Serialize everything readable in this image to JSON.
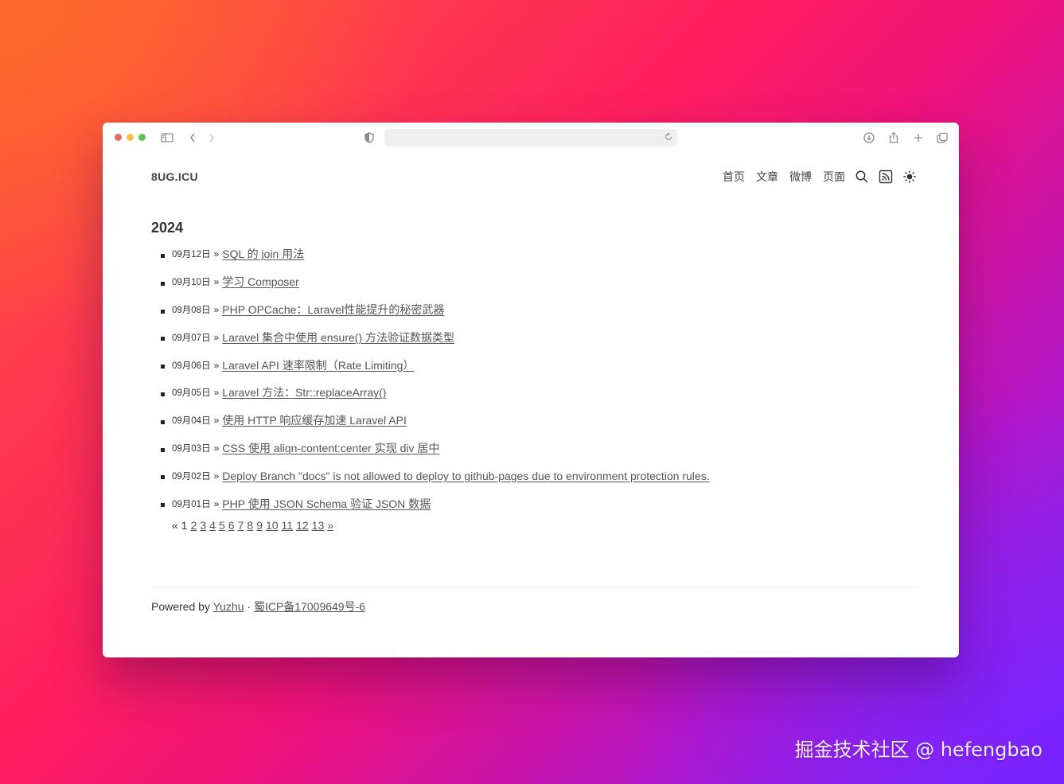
{
  "browser": {
    "address_value": "",
    "icons": [
      "sidebar-icon",
      "back-icon",
      "forward-icon",
      "shield-icon",
      "reload-icon",
      "download-icon",
      "share-icon",
      "new-tab-icon",
      "tabs-overview-icon"
    ]
  },
  "site": {
    "brand": "8UG.ICU",
    "nav": [
      "首页",
      "文章",
      "微博",
      "页面"
    ],
    "nav_icons": [
      "search-icon",
      "rss-icon",
      "theme-sun-icon"
    ]
  },
  "archive": {
    "year": "2024",
    "separator": "»",
    "posts": [
      {
        "date": "09月12日",
        "title": "SQL 的 join 用法"
      },
      {
        "date": "09月10日",
        "title": "学习 Composer"
      },
      {
        "date": "09月08日",
        "title": "PHP OPCache：Laravel性能提升的秘密武器"
      },
      {
        "date": "09月07日",
        "title": "Laravel 集合中使用 ensure() 方法验证数据类型"
      },
      {
        "date": "09月06日",
        "title": "Laravel API 速率限制（Rate Limiting）"
      },
      {
        "date": "09月05日",
        "title": "Laravel 方法：Str::replaceArray()"
      },
      {
        "date": "09月04日",
        "title": "使用 HTTP 响应缓存加速 Laravel API"
      },
      {
        "date": "09月03日",
        "title": "CSS 使用 align-content:center 实现 div 居中"
      },
      {
        "date": "09月02日",
        "title": "Deploy Branch \"docs\" is not allowed to deploy to github-pages due to environment protection rules."
      },
      {
        "date": "09月01日",
        "title": "PHP 使用 JSON Schema 验证 JSON 数据"
      }
    ]
  },
  "pagination": {
    "prev": "«",
    "current": "1",
    "pages": [
      "2",
      "3",
      "4",
      "5",
      "6",
      "7",
      "8",
      "9",
      "10",
      "11",
      "12",
      "13"
    ],
    "next": "»"
  },
  "footer": {
    "powered_by": "Powered by",
    "author_link": "Yuzhu",
    "dot": "·",
    "icp_link": "蜀ICP备17009649号-6"
  },
  "watermark": "掘金技术社区 @ hefengbao"
}
